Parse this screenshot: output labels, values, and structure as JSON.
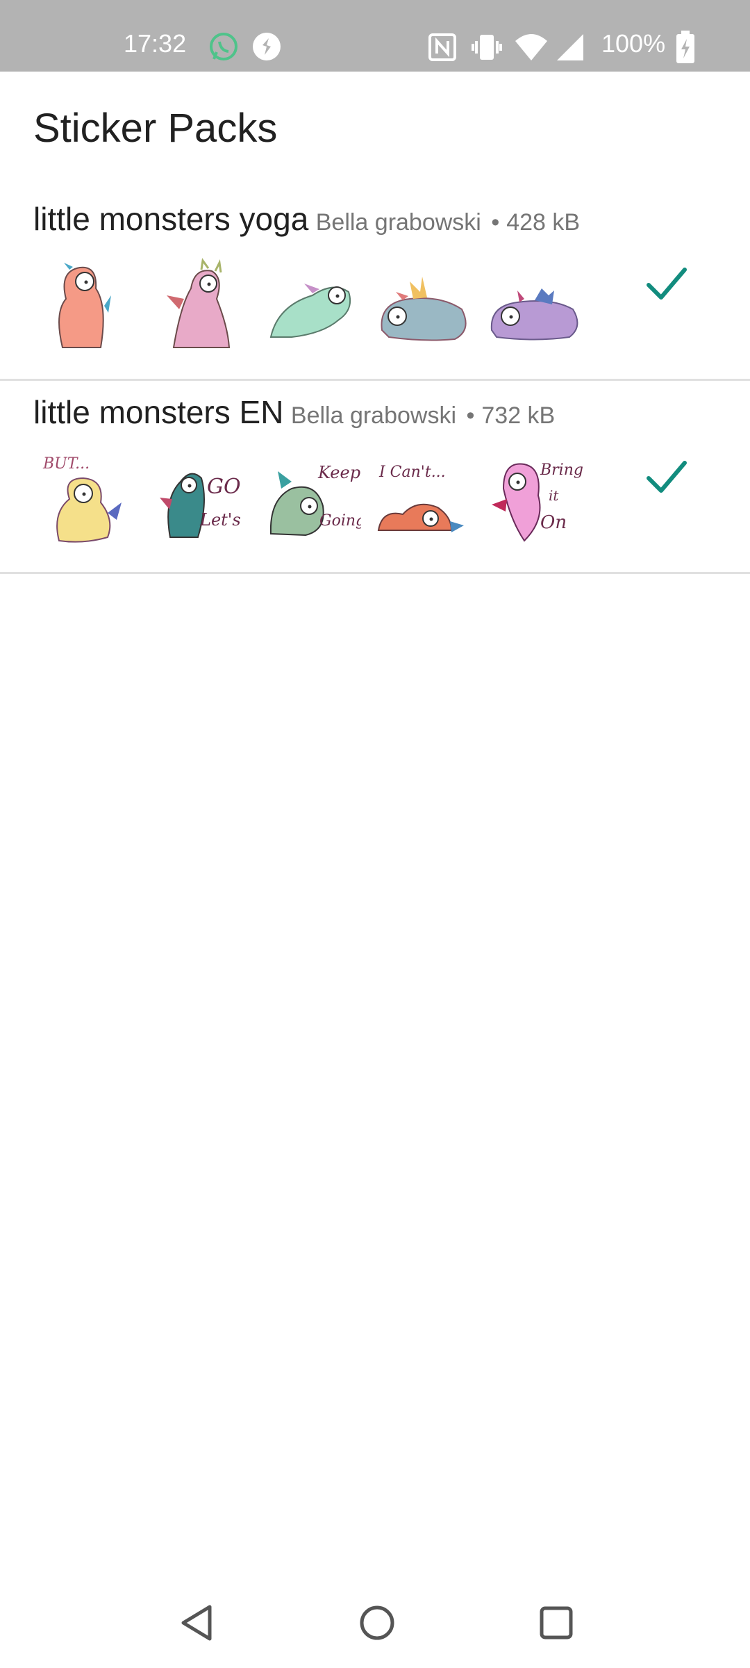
{
  "status_bar": {
    "time": "17:32",
    "battery": "100%",
    "icons": [
      "whatsapp-icon",
      "shazam-icon",
      "nfc-icon",
      "vibrate-icon",
      "wifi-icon",
      "signal-icon",
      "battery-charging-icon"
    ]
  },
  "app": {
    "title": "Sticker Packs"
  },
  "packs": [
    {
      "name": "little monsters yoga",
      "author": "Bella grabowski",
      "separator": "•",
      "size": "428 kB",
      "added": true
    },
    {
      "name": "little monsters EN",
      "author": "Bella grabowski",
      "separator": "•",
      "size": "732 kB",
      "added": true
    }
  ],
  "sticker_text": {
    "pack2": [
      "BUT...",
      "GO",
      "Let's",
      "Keep",
      "Going",
      "I Can't...",
      "Bring",
      "it",
      "On"
    ]
  },
  "colors": {
    "accent": "#128C7E",
    "status_bar": "#b3b3b3"
  },
  "nav_bar": {
    "icons": [
      "back-icon",
      "home-icon",
      "recents-icon"
    ]
  }
}
